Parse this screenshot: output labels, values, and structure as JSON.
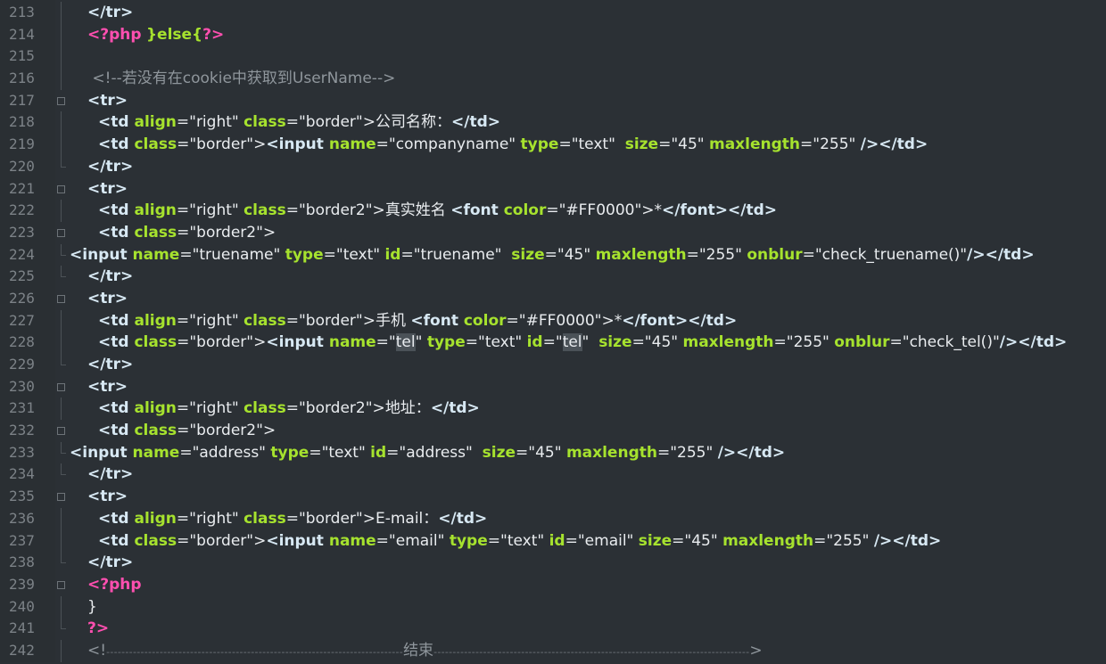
{
  "editor": {
    "lines": [
      {
        "num": "213"
      },
      {
        "num": "214"
      },
      {
        "num": "215"
      },
      {
        "num": "216"
      },
      {
        "num": "217"
      },
      {
        "num": "218"
      },
      {
        "num": "219"
      },
      {
        "num": "220"
      },
      {
        "num": "221"
      },
      {
        "num": "222"
      },
      {
        "num": "223"
      },
      {
        "num": "224"
      },
      {
        "num": "225"
      },
      {
        "num": "226"
      },
      {
        "num": "227"
      },
      {
        "num": "228"
      },
      {
        "num": "229"
      },
      {
        "num": "230"
      },
      {
        "num": "231"
      },
      {
        "num": "232"
      },
      {
        "num": "233"
      },
      {
        "num": "234"
      },
      {
        "num": "235"
      },
      {
        "num": "236"
      },
      {
        "num": "237"
      },
      {
        "num": "238"
      },
      {
        "num": "239"
      },
      {
        "num": "240"
      },
      {
        "num": "241"
      },
      {
        "num": "242"
      }
    ],
    "text": {
      "l213": "</tr>",
      "l214_php": "<?php",
      "l214_else": "}else{",
      "l214_close": "?>",
      "l216_comment": "<!--若没有在cookie中获取到UserName-->",
      "l217": "<tr>",
      "l218_open": "<td ",
      "l218_align": "align",
      "l218_eq1": "=\"right\" ",
      "l218_class": "class",
      "l218_eq2": "=\"border\">",
      "l218_zh": "公司名称：",
      "l218_close": "</td>",
      "l219_open": "<td ",
      "l219_class": "class",
      "l219_eq1": "=\"border\">",
      "l219_input": "<input ",
      "l219_name": "name",
      "l219_eq2": "=\"companyname\" ",
      "l219_type": "type",
      "l219_eq3": "=\"text\"  ",
      "l219_size": "size",
      "l219_eq4": "=\"45\" ",
      "l219_max": "maxlength",
      "l219_eq5": "=\"255\" ",
      "l219_close": "/></td>",
      "l220": "</tr>",
      "l221": "<tr>",
      "l222_open": "<td ",
      "l222_align": "align",
      "l222_eq1": "=\"right\" ",
      "l222_class": "class",
      "l222_eq2": "=\"border2\">",
      "l222_zh": "真实姓名 ",
      "l222_font": "<font ",
      "l222_color": "color",
      "l222_eq3": "=\"#FF0000\">",
      "l222_star": "*",
      "l222_close": "</font></td>",
      "l223_open": "<td ",
      "l223_class": "class",
      "l223_eq": "=\"border2\">",
      "l224_input": "<input ",
      "l224_name": "name",
      "l224_eq1": "=\"truename\" ",
      "l224_type": "type",
      "l224_eq2": "=\"text\" ",
      "l224_id": "id",
      "l224_eq3": "=\"truename\"  ",
      "l224_size": "size",
      "l224_eq4": "=\"45\" ",
      "l224_max": "maxlength",
      "l224_eq5": "=\"255\" ",
      "l224_onblur": "onblur",
      "l224_eq6": "=\"check_truename()\"",
      "l224_close": "/></td>",
      "l225": "</tr>",
      "l226": "<tr>",
      "l227_open": "<td ",
      "l227_align": "align",
      "l227_eq1": "=\"right\" ",
      "l227_class": "class",
      "l227_eq2": "=\"border\">",
      "l227_zh": "手机 ",
      "l227_font": "<font ",
      "l227_color": "color",
      "l227_eq3": "=\"#FF0000\">",
      "l227_star": "*",
      "l227_close": "</font></td>",
      "l228_open": "<td ",
      "l228_class": "class",
      "l228_eq1": "=\"border\">",
      "l228_input": "<input ",
      "l228_name": "name",
      "l228_eq2a": "=\"",
      "l228_tel1": "tel",
      "l228_eq2b": "\" ",
      "l228_type": "type",
      "l228_eq3": "=\"text\" ",
      "l228_id": "id",
      "l228_eq4a": "=\"",
      "l228_tel2": "tel",
      "l228_eq4b": "\"  ",
      "l228_size": "size",
      "l228_eq5": "=\"45\" ",
      "l228_max": "maxlength",
      "l228_eq6": "=\"255\" ",
      "l228_onblur": "onblur",
      "l228_eq7": "=\"check_tel()\"",
      "l228_close": "/></td>",
      "l229": "</tr>",
      "l230": "<tr>",
      "l231_open": "<td ",
      "l231_align": "align",
      "l231_eq1": "=\"right\" ",
      "l231_class": "class",
      "l231_eq2": "=\"border2\">",
      "l231_zh": "地址：",
      "l231_close": "</td>",
      "l232_open": "<td ",
      "l232_class": "class",
      "l232_eq": "=\"border2\">",
      "l233_input": "<input ",
      "l233_name": "name",
      "l233_eq1": "=\"address\" ",
      "l233_type": "type",
      "l233_eq2": "=\"text\" ",
      "l233_id": "id",
      "l233_eq3": "=\"address\"  ",
      "l233_size": "size",
      "l233_eq4": "=\"45\" ",
      "l233_max": "maxlength",
      "l233_eq5": "=\"255\" ",
      "l233_close": "/></td>",
      "l234": "</tr>",
      "l235": "<tr>",
      "l236_open": "<td ",
      "l236_align": "align",
      "l236_eq1": "=\"right\" ",
      "l236_class": "class",
      "l236_eq2": "=\"border\">",
      "l236_txt": "E-mail：",
      "l236_close": "</td>",
      "l237_open": "<td ",
      "l237_class": "class",
      "l237_eq1": "=\"border\">",
      "l237_input": "<input ",
      "l237_name": "name",
      "l237_eq2": "=\"email\" ",
      "l237_type": "type",
      "l237_eq3": "=\"text\" ",
      "l237_id": "id",
      "l237_eq4": "=\"email\" ",
      "l237_size": "size",
      "l237_eq5": "=\"45\" ",
      "l237_max": "maxlength",
      "l237_eq6": "=\"255\" ",
      "l237_close": "/></td>",
      "l238": "</tr>",
      "l239": "<?php",
      "l240": "}",
      "l241": "?>",
      "l242_start": "<!",
      "l242_dashes1": "------------------------------------------------------------------------------",
      "l242_zh": "结束",
      "l242_dashes2": "-----------------------------------------------------------------------------------",
      "l242_end": ">"
    }
  }
}
